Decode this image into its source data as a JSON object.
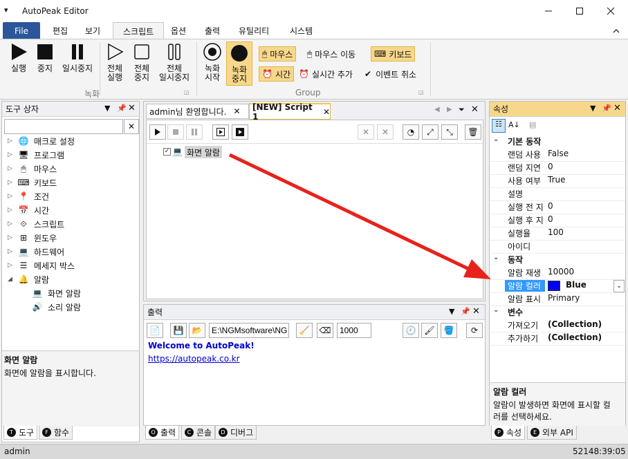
{
  "window": {
    "title": "AutoPeak Editor",
    "menu_glyph": "▾"
  },
  "ribbon_tabs": [
    "File",
    "편집",
    "보기",
    "스크립트",
    "옵션",
    "출력",
    "유틸리티",
    "시스템"
  ],
  "ribbon": {
    "run": "실행",
    "stop": "중지",
    "pause": "일시중지",
    "all_run_1": "전체",
    "all_run_2": "실행",
    "all_stop_1": "전체",
    "all_stop_2": "중지",
    "all_pause_1": "전체",
    "all_pause_2": "일시중지",
    "rec_start_1": "녹화",
    "rec_start_2": "시작",
    "rec_stop_1": "녹화",
    "rec_stop_2": "중지",
    "mouse": "마우스",
    "mouse_move": "마우스 이동",
    "keyboard": "키보드",
    "time": "시간",
    "add_realtime": "실시간 추가",
    "cancel_event": "이벤트 취소",
    "group_record": "녹화",
    "group_group": "Group"
  },
  "toolbox": {
    "title": "도구 상자",
    "search_value": "",
    "items": [
      "매크로 설정",
      "프로그램",
      "마우스",
      "키보드",
      "조건",
      "시간",
      "스크립트",
      "윈도우",
      "하드웨어",
      "메세지 박스",
      "알람"
    ],
    "children": [
      "화면 알람",
      "소리 알람"
    ],
    "desc_title": "화면 알람",
    "desc_text": "화면에 알람을 표시합니다.",
    "tabs": [
      "도구",
      "함수"
    ],
    "tab_letters": [
      "T",
      "F"
    ]
  },
  "editor": {
    "tabs": [
      "admin님 환영합니다.",
      "[NEW] Script 1"
    ],
    "script_item": "화면 알람",
    "arrow_color": "#e8221b"
  },
  "output": {
    "title": "출력",
    "path": "E:\\NGMsoftware\\NG",
    "number": "1000",
    "lines": [
      "Welcome to AutoPeak!",
      "https://autopeak.co.kr"
    ],
    "tabs": [
      "출력",
      "콘솔",
      "디버그"
    ],
    "tab_letters": [
      "O",
      "C",
      "D"
    ]
  },
  "properties": {
    "title": "속성",
    "categories": [
      {
        "name": "기본 동작",
        "rows": [
          [
            "랜덤 사용",
            "False"
          ],
          [
            "랜덤 지연",
            "0"
          ],
          [
            "사용 여부",
            "True"
          ],
          [
            "설명",
            ""
          ],
          [
            "실행 전 지",
            "0"
          ],
          [
            "실행 후 지",
            "0"
          ],
          [
            "실행율",
            "100"
          ],
          [
            "아이디",
            ""
          ]
        ]
      },
      {
        "name": "동작",
        "rows": [
          [
            "알람 재생",
            "10000"
          ],
          [
            "알람 컬러",
            "Blue"
          ],
          [
            "알람 표시",
            "Primary"
          ]
        ]
      },
      {
        "name": "변수",
        "rows": [
          [
            "가져오기",
            "(Collection)"
          ],
          [
            "추가하기",
            "(Collection)"
          ]
        ]
      }
    ],
    "selected_color": "#0000ff",
    "desc_title": "알람 컬러",
    "desc_text_1": "알람이 발생하면 화면에 표시할 컬",
    "desc_text_2": "러를 선택하세요.",
    "tabs": [
      "속성",
      "외부 API"
    ],
    "tab_letters": [
      "P",
      "E"
    ]
  },
  "status": {
    "user": "admin",
    "time": "52148:39:05"
  }
}
